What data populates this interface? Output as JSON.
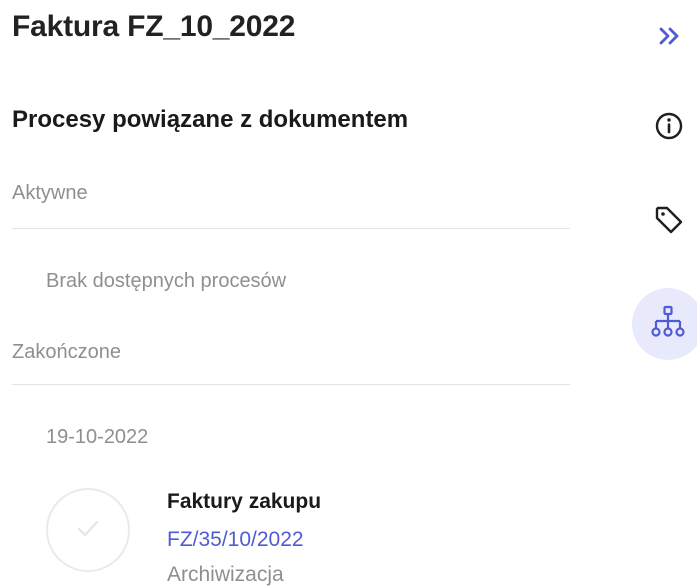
{
  "document": {
    "title": "Faktura FZ_10_2022"
  },
  "processes": {
    "heading": "Procesy powiązane z dokumentem",
    "active": {
      "label": "Aktywne",
      "empty_message": "Brak dostępnych procesów"
    },
    "completed": {
      "label": "Zakończone",
      "items": [
        {
          "date": "19-10-2022",
          "name": "Faktury zakupu",
          "number": "FZ/35/10/2022",
          "stage": "Archiwizacja"
        }
      ]
    }
  },
  "side_panel": {
    "buttons": [
      {
        "icon": "double-chevron-right-icon"
      },
      {
        "icon": "info-icon"
      },
      {
        "icon": "tag-icon"
      },
      {
        "icon": "hierarchy-icon",
        "active": true
      }
    ]
  },
  "colors": {
    "accent": "#4f5bd5",
    "active_bg": "#e8eafc",
    "muted_text": "#8f8f8f"
  }
}
